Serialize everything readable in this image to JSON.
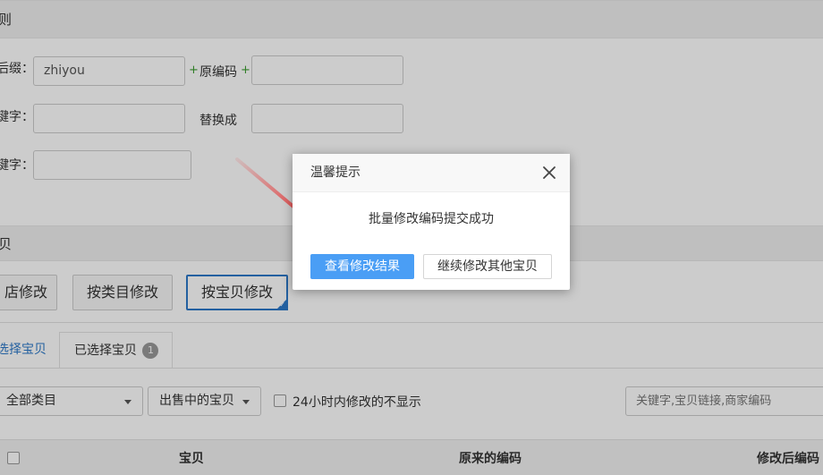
{
  "background": {
    "section1": {
      "title": "则"
    },
    "suffix_label": "后缀：",
    "suffix_value": "zhiyou",
    "plus_sign": "+",
    "original_code_label": "原编码",
    "keyword1_label": "键字：",
    "replace_with_label": "替换成",
    "keyword2_label": "键字：",
    "section2": {
      "title": "贝"
    },
    "mode_buttons": [
      {
        "label": "店修改"
      },
      {
        "label": "按类目修改"
      },
      {
        "label": "按宝贝修改"
      }
    ],
    "tabs": [
      {
        "label": "选择宝贝"
      },
      {
        "label": "已选择宝贝"
      }
    ],
    "selected_count": "1",
    "category_select": "全部类目",
    "status_select": "出售中的宝贝",
    "hide_recent_label": "24小时内修改的不显示",
    "search_placeholder": "关键字,宝贝链接,商家编码",
    "table_headers": {
      "item": "宝贝",
      "original_code": "原来的编码",
      "modified_code": "修改后编码"
    }
  },
  "modal": {
    "title": "温馨提示",
    "message": "批量修改编码提交成功",
    "primary_button": "查看修改结果",
    "secondary_button": "继续修改其他宝贝"
  },
  "colors": {
    "primary": "#4a9ef5",
    "active_border": "#2c78c8",
    "arrow": "#e8292a",
    "plus": "#3a9d2f"
  }
}
